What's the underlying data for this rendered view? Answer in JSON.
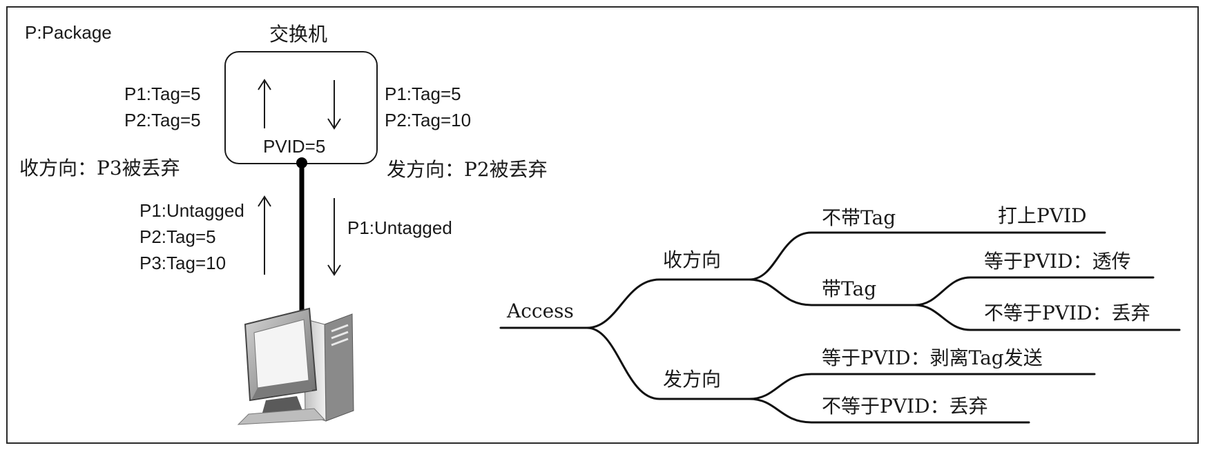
{
  "legend": "P:Package",
  "switch_label": "交换机",
  "pvid_label": "PVID=5",
  "left_in": {
    "line1": "P1:Tag=5",
    "line2": "P2:Tag=5"
  },
  "right_out": {
    "line1": "P1:Tag=5",
    "line2": "P2:Tag=10"
  },
  "recv_note": "收方向：P3被丢弃",
  "send_note": "发方向：P2被丢弃",
  "up_packets": {
    "line1": "P1:Untagged",
    "line2": "P2:Tag=5",
    "line3": "P3:Tag=10"
  },
  "down_packets": {
    "line1": "P1:Untagged"
  },
  "tree": {
    "root": "Access",
    "recv": "收方向",
    "send": "发方向",
    "untagged": "不带Tag",
    "tagged": "带Tag",
    "leaf_add_pvid": "打上PVID",
    "leaf_eq_pass": "等于PVID：透传",
    "leaf_neq_drop_recv": "不等于PVID：丢弃",
    "leaf_eq_strip": "等于PVID：剥离Tag发送",
    "leaf_neq_drop_send": "不等于PVID：丢弃"
  }
}
